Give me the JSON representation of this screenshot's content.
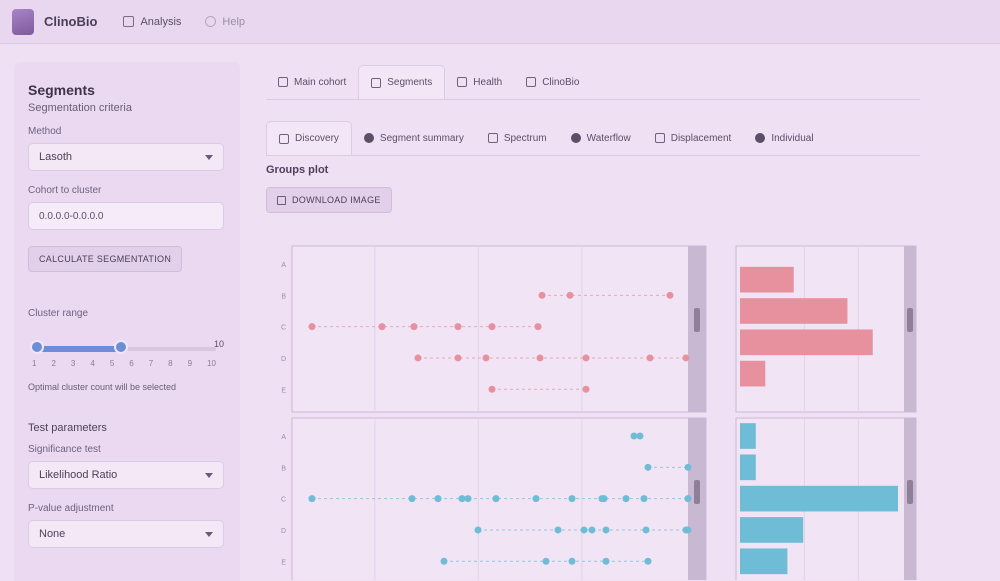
{
  "app": {
    "brand": "ClinoBio"
  },
  "nav": {
    "links": [
      {
        "label": "Analysis",
        "icon": "grid-icon"
      },
      {
        "label": "Help",
        "icon": "info-icon"
      }
    ]
  },
  "sidebar": {
    "title": "Segments",
    "subtitle": "Segmentation criteria",
    "method_label": "Method",
    "method_value": "Lasoth",
    "cohort_label": "Cohort to cluster",
    "cohort_value": "0.0.0.0-0.0.0.0",
    "compute_button": "CALCULATE SEGMENTATION",
    "range_label": "Cluster range",
    "range_max": "10",
    "range_ticks": [
      "1",
      "2",
      "3",
      "4",
      "5",
      "6",
      "7",
      "8",
      "9",
      "10"
    ],
    "hint": "Optimal cluster count will be selected",
    "test_section": "Test parameters",
    "sig_label": "Significance test",
    "sig_value": "Likelihood Ratio",
    "pval_label": "P-value adjustment",
    "pval_value": "None"
  },
  "tabs_primary": [
    {
      "label": "Main cohort",
      "icon": "users-icon",
      "active": false
    },
    {
      "label": "Segments",
      "icon": "segments-icon",
      "active": true
    },
    {
      "label": "Health",
      "icon": "heart-icon",
      "active": false
    },
    {
      "label": "ClinoBio",
      "icon": "info-icon",
      "active": false
    }
  ],
  "tabs_secondary": [
    {
      "label": "Discovery",
      "icon": "discovery-icon",
      "active": true
    },
    {
      "label": "Segment summary",
      "icon": "summary-icon",
      "active": false
    },
    {
      "label": "Spectrum",
      "icon": "spectrum-icon",
      "active": false
    },
    {
      "label": "Waterflow",
      "icon": "waterflow-icon",
      "active": false
    },
    {
      "label": "Displacement",
      "icon": "displacement-icon",
      "active": false
    },
    {
      "label": "Individual",
      "icon": "individual-icon",
      "active": false
    }
  ],
  "section": {
    "title": "Groups plot",
    "download_label": "DOWNLOAD IMAGE"
  },
  "colors": {
    "red": "#e8919e",
    "blue": "#6fbcd6",
    "accent": "#6a8fd6",
    "background": "#efe0f4"
  },
  "chart_data": {
    "type": "scatter",
    "panels": [
      {
        "series": "red",
        "rows": [
          {
            "y": "A",
            "points": []
          },
          {
            "y": "B",
            "points": [
              240,
              268,
              368
            ]
          },
          {
            "y": "C",
            "points": [
              10,
              80,
              112,
              156,
              190,
              236
            ]
          },
          {
            "y": "D",
            "points": [
              116,
              156,
              184,
              238,
              284,
              348,
              384
            ]
          },
          {
            "y": "E",
            "points": [
              190,
              284
            ]
          }
        ],
        "bars": [
          0.34,
          0.68,
          0.84,
          0.16
        ]
      },
      {
        "series": "blue",
        "rows": [
          {
            "y": "A",
            "points": [
              332,
              338
            ]
          },
          {
            "y": "B",
            "points": [
              346,
              386
            ]
          },
          {
            "y": "C",
            "points": [
              10,
              110,
              136,
              160,
              166,
              194,
              234,
              270,
              300,
              302,
              324,
              342,
              386
            ]
          },
          {
            "y": "D",
            "points": [
              176,
              256,
              282,
              290,
              304,
              344,
              384,
              386
            ]
          },
          {
            "y": "E",
            "points": [
              142,
              244,
              270,
              304,
              346
            ]
          }
        ],
        "bars": [
          0.1,
          0.1,
          1.0,
          0.4,
          0.3
        ]
      }
    ]
  }
}
